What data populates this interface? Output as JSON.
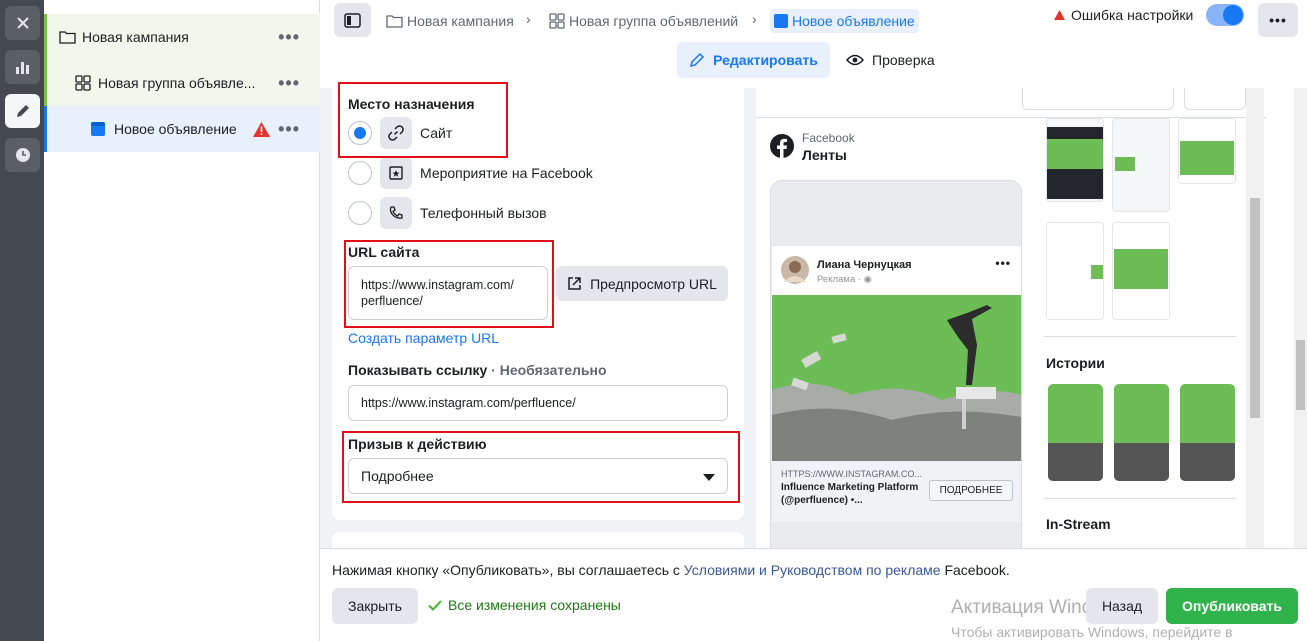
{
  "tree": {
    "campaign": "Новая кампания",
    "adset": "Новая группа объявле...",
    "ad": "Новое объявление"
  },
  "breadcrumbs": {
    "campaign": "Новая кампания",
    "adset": "Новая группа объявлений",
    "ad": "Новое объявление"
  },
  "status": {
    "error_text": "Ошибка настройки",
    "toggle_on": true
  },
  "tabs": {
    "edit": "Редактировать",
    "review": "Проверка"
  },
  "form": {
    "destination_label": "Место назначения",
    "options": [
      {
        "label": "Сайт",
        "selected": true
      },
      {
        "label": "Мероприятие на Facebook",
        "selected": false
      },
      {
        "label": "Телефонный вызов",
        "selected": false
      }
    ],
    "url_label": "URL сайта",
    "url_line1": "https://www.instagram.com/",
    "url_line2": "perfluence/",
    "preview_url_button": "Предпросмотр URL",
    "create_param_link": "Создать параметр URL",
    "display_link_label": "Показывать ссылку",
    "display_link_optional": "· Необязательно",
    "display_link_value": "https://www.instagram.com/perfluence/",
    "cta_label": "Призыв к действию",
    "cta_value": "Подробнее"
  },
  "preview": {
    "platform": "Facebook",
    "placement": "Ленты",
    "post_name": "Лиана Чернуцкая",
    "post_sub": "Реклама · ",
    "link_url": "HTTPS://WWW.INSTAGRAM.CO...",
    "link_title": "Influence Marketing Platform (@perfluence) •...",
    "link_cta": "ПОДРОБНЕЕ",
    "section_stories": "Истории",
    "section_instream": "In-Stream"
  },
  "footer": {
    "terms_prefix": "Нажимая кнопку «Опубликовать», вы соглашаетесь с ",
    "terms_link": "Условиями и Руководством по рекламе",
    "terms_suffix": " Facebook.",
    "close_button": "Закрыть",
    "saved_text": "Все изменения сохранены",
    "back_button": "Назад",
    "publish_button": "Опубликовать",
    "watermark_title": "Активация Windows",
    "watermark_sub": "Чтобы активировать Windows, перейдите в"
  },
  "colors": {
    "accent": "#1877f2",
    "success": "#2fb34a",
    "highlight_box": "#e0101a",
    "preview_green": "#6cbd56"
  }
}
